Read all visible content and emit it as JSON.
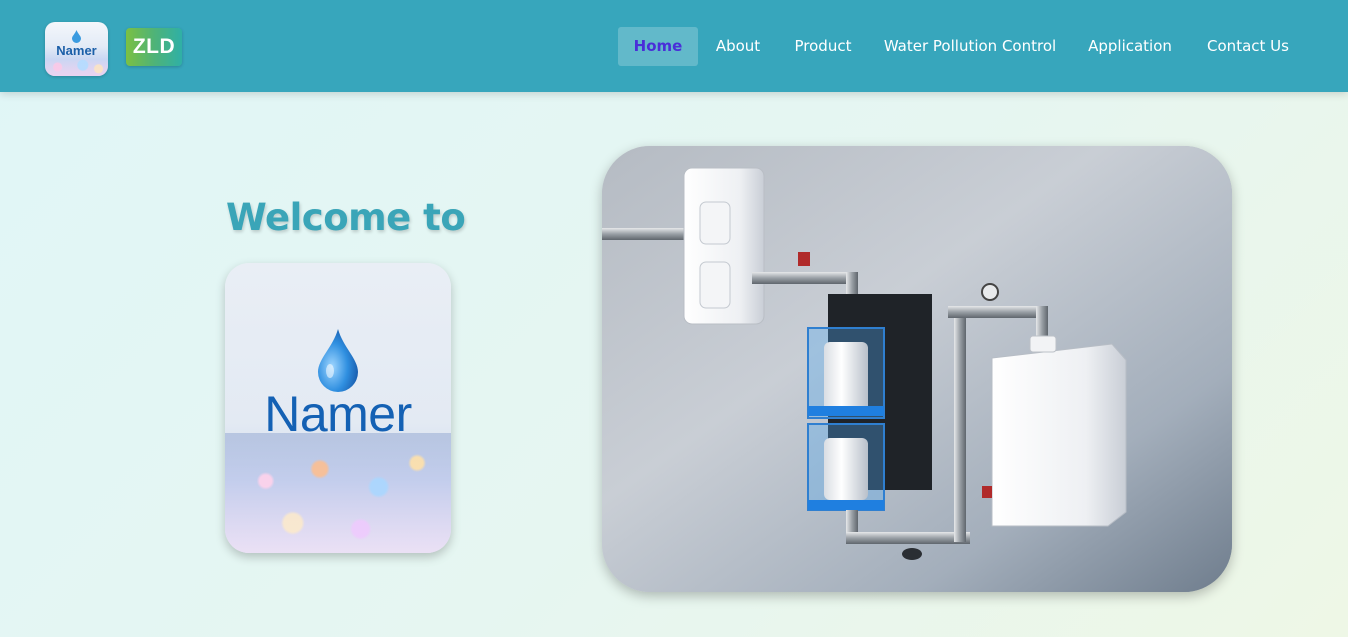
{
  "header": {
    "logo_text": "Namer",
    "badge_text": "ZLD",
    "nav": [
      {
        "label": "Home",
        "active": true
      },
      {
        "label": "About",
        "active": false
      },
      {
        "label": "Product",
        "active": false
      },
      {
        "label": "Water Pollution Control",
        "active": false
      },
      {
        "label": "Application",
        "active": false
      },
      {
        "label": "Contact Us",
        "active": false
      }
    ]
  },
  "hero": {
    "welcome": "Welcome to",
    "brand": "Namer",
    "image_icon": "water-filtration-system-image"
  },
  "colors": {
    "header_bg": "#37a6bc",
    "active_nav_text": "#4a2fd8",
    "welcome_text": "#3aa5b8",
    "brand_text": "#1461b4"
  }
}
